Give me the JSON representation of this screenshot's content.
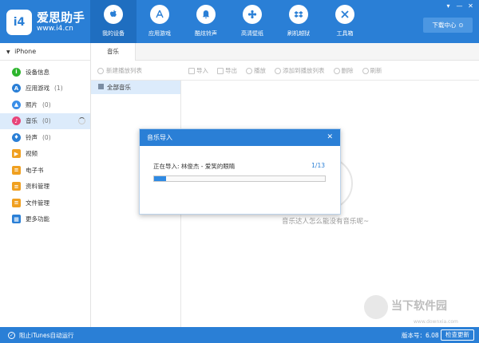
{
  "app": {
    "logo_mark": "i4",
    "name": "爱思助手",
    "url": "www.i4.cn"
  },
  "nav": [
    {
      "label": "我的设备",
      "icon": "apple-icon",
      "active": true
    },
    {
      "label": "应用游戏",
      "icon": "app-store-icon",
      "active": false
    },
    {
      "label": "酷炫铃声",
      "icon": "bell-icon",
      "active": false
    },
    {
      "label": "高清壁纸",
      "icon": "flower-icon",
      "active": false
    },
    {
      "label": "刷机越狱",
      "icon": "dropbox-icon",
      "active": false
    },
    {
      "label": "工具箱",
      "icon": "tools-icon",
      "active": false
    }
  ],
  "header": {
    "download_label": "下载中心",
    "download_icon": "download-icon"
  },
  "sidebar": {
    "device": "iPhone",
    "items": [
      {
        "label": "设备信息",
        "count": "",
        "color": "#2db52d",
        "glyph": "i"
      },
      {
        "label": "应用游戏",
        "count": "(1)",
        "color": "#2a7fd6",
        "glyph": "A"
      },
      {
        "label": "照片",
        "count": "(0)",
        "color": "#3a8ee8",
        "glyph": "▲"
      },
      {
        "label": "音乐",
        "count": "(0)",
        "color": "#e8457a",
        "glyph": "♪"
      },
      {
        "label": "铃声",
        "count": "(0)",
        "color": "#2a7fd6",
        "glyph": "♦"
      },
      {
        "label": "视频",
        "count": "",
        "color": "#f0a020",
        "glyph": "▶"
      },
      {
        "label": "电子书",
        "count": "",
        "color": "#f0a020",
        "glyph": "≡"
      },
      {
        "label": "资料管理",
        "count": "",
        "color": "#f0a020",
        "glyph": "≡"
      },
      {
        "label": "文件管理",
        "count": "",
        "color": "#f0a020",
        "glyph": "≡"
      },
      {
        "label": "更多功能",
        "count": "",
        "color": "#2a7fd6",
        "glyph": "▦"
      }
    ]
  },
  "content": {
    "tab": "音乐",
    "new_playlist": "新建播放列表",
    "tools": [
      "导入",
      "导出",
      "播放",
      "添加到播放列表",
      "删除",
      "刷新"
    ],
    "playlist": "全部音乐",
    "empty_text": "音乐达人怎么能没有音乐呢~"
  },
  "dialog": {
    "title": "音乐导入",
    "close": "✕",
    "status": "正在导入: 林俊杰 - 爱笑的眼睛",
    "count": "1/13",
    "progress_percent": 7
  },
  "statusbar": {
    "itunes_label": "阻止iTunes自动运行",
    "version": "版本号：6.08",
    "check_update": "检查更新"
  },
  "watermark": {
    "name": "当下软件园",
    "url": "www.downxia.com"
  },
  "colors": {
    "brand": "#2a7fd6",
    "active_bg": "#dcebfb"
  }
}
